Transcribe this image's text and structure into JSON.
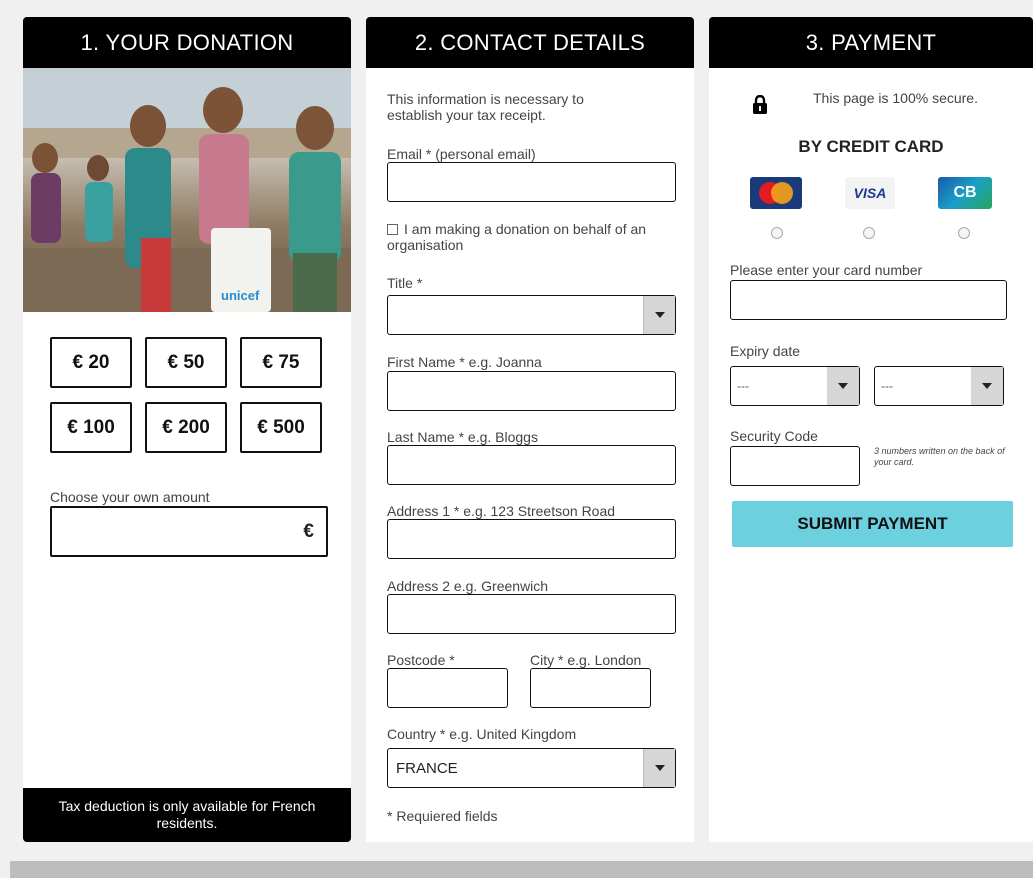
{
  "donation": {
    "header": "1. YOUR DONATION",
    "amounts": [
      "€ 20",
      "€ 50",
      "€ 75",
      "€ 100",
      "€ 200",
      "€ 500"
    ],
    "own_amount_label": "Choose your own amount",
    "currency_symbol": "€",
    "tax_note": "Tax deduction is only available for French residents.",
    "photo_logo_text": "unicef"
  },
  "contact": {
    "header": "2. CONTACT DETAILS",
    "intro": "This information is necessary to establish your tax receipt.",
    "email_label": "Email * (personal email)",
    "org_checkbox_label": "I am making a donation on behalf of an organisation",
    "title_label": "Title *",
    "title_value": "",
    "first_name_label": "First Name * e.g. Joanna",
    "last_name_label": "Last Name * e.g. Bloggs",
    "address1_label": "Address 1 * e.g. 123 Streetson Road",
    "address2_label": "Address 2 e.g. Greenwich",
    "postcode_label": "Postcode *",
    "city_label": "City * e.g. London",
    "country_label": "Country * e.g. United Kingdom",
    "country_value": "FRANCE",
    "required_note": "* Requiered fields"
  },
  "payment": {
    "header": "3. PAYMENT",
    "secure_text": "This page is 100% secure.",
    "method_title": "BY CREDIT CARD",
    "cards": [
      "MasterCard",
      "VISA",
      "CB"
    ],
    "card_number_label": "Please enter your card number",
    "expiry_label": "Expiry date",
    "expiry_month_value": "---",
    "expiry_year_value": "---",
    "security_label": "Security Code",
    "security_hint": "3 numbers written on the back of your card.",
    "submit_label": "SUBMIT PAYMENT"
  },
  "colors": {
    "header_bg": "#000000",
    "submit_bg": "#6dd0df",
    "page_bg": "#f0f0f0"
  }
}
